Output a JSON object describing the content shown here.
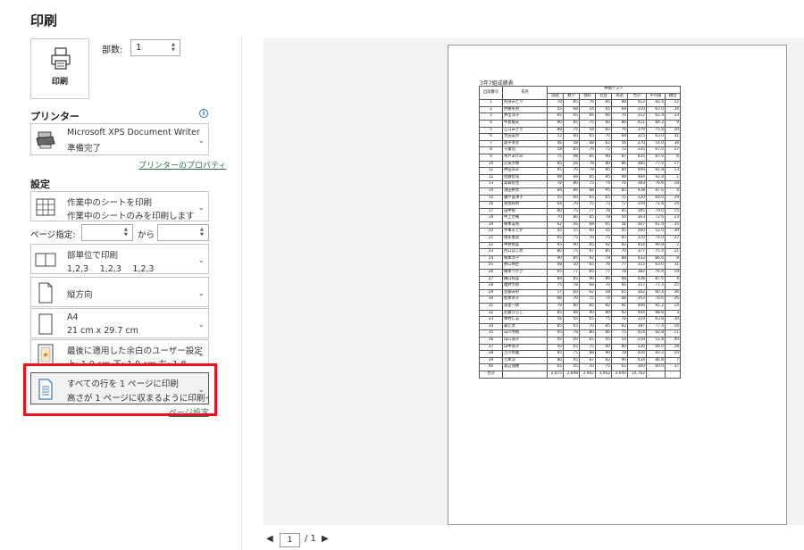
{
  "header": {
    "title": "印刷"
  },
  "print_button": {
    "label": "印刷"
  },
  "copies": {
    "label": "部数:",
    "value": "1"
  },
  "printer": {
    "section_label": "プリンター",
    "info_icon": "i",
    "name": "Microsoft XPS Document Writer",
    "status": "準備完了",
    "properties_link": "プリンターのプロパティ"
  },
  "settings": {
    "section_label": "設定",
    "scope": {
      "line1": "作業中のシートを印刷",
      "line2": "作業中のシートのみを印刷します"
    },
    "pages_label": "ページ指定:",
    "pages_to": "から",
    "collate": {
      "line1": "部単位で印刷",
      "line2": "1,2,3　 1,2,3　 1,2,3"
    },
    "orientation": {
      "line1": "縦方向"
    },
    "paper": {
      "line1": "A4",
      "line2": "21 cm x 29.7 cm"
    },
    "margins": {
      "line1": "最後に適用した余白のユーザー設定",
      "line2": "上: 1.9 cm 下: 1.9 cm 左: 1.8..."
    },
    "scaling": {
      "line1": "すべての行を 1 ページに印刷",
      "line2": "高さが 1 ページに収まるように印刷イ..."
    },
    "page_setup_link": "ページ設定"
  },
  "pager": {
    "current": "1",
    "total": "/ 1"
  },
  "preview": {
    "sheet_title": "3年7組成績表",
    "headers": {
      "num": "出席番号",
      "name": "氏名",
      "group": "中間テスト",
      "subjects": [
        "国語",
        "数学",
        "理科",
        "社会",
        "英語",
        "合計",
        "平均値",
        "順位"
      ]
    },
    "rows": [
      [
        "1",
        "阿部みどり",
        "78",
        "85",
        "76",
        "85",
        "88",
        "412",
        "82.4",
        "12"
      ],
      [
        "2",
        "伊藤冬男",
        "55",
        "68",
        "54",
        "65",
        "68",
        "310",
        "62.0",
        "34"
      ],
      [
        "3",
        "井出洋子",
        "65",
        "45",
        "66",
        "66",
        "70",
        "312",
        "62.4",
        "33"
      ],
      [
        "4",
        "牛島陽夫",
        "90",
        "85",
        "75",
        "85",
        "86",
        "421",
        "84.2",
        "9"
      ],
      [
        "5",
        "江口みさき",
        "88",
        "75",
        "58",
        "82",
        "76",
        "379",
        "75.8",
        "20"
      ],
      [
        "6",
        "大田美奈",
        "52",
        "60",
        "65",
        "70",
        "68",
        "315",
        "63.0",
        "31"
      ],
      [
        "7",
        "奥平孝彦",
        "46",
        "58",
        "48",
        "62",
        "56",
        "270",
        "54.0",
        "38"
      ],
      [
        "8",
        "千葉浩",
        "58",
        "65",
        "70",
        "75",
        "72",
        "335",
        "67.0",
        "27"
      ],
      [
        "9",
        "木戸あけみ",
        "75",
        "98",
        "85",
        "90",
        "87",
        "435",
        "87.0",
        "6"
      ],
      [
        "10",
        "久保大樹",
        "85",
        "56",
        "78",
        "80",
        "86",
        "385",
        "77.0",
        "17"
      ],
      [
        "11",
        "神田あみ",
        "95",
        "70",
        "78",
        "85",
        "84",
        "409",
        "81.8",
        "13"
      ],
      [
        "12",
        "佐藤智道",
        "98",
        "88",
        "85",
        "95",
        "98",
        "464",
        "92.8",
        "1"
      ],
      [
        "13",
        "高森智也",
        "78",
        "80",
        "75",
        "74",
        "76",
        "383",
        "76.6",
        "18"
      ],
      [
        "14",
        "須田裕太",
        "84",
        "86",
        "88",
        "95",
        "85",
        "438",
        "87.6",
        "4"
      ],
      [
        "15",
        "瀬戸美津子",
        "55",
        "60",
        "65",
        "65",
        "75",
        "320",
        "64.0",
        "29"
      ],
      [
        "16",
        "曽我和明",
        "64",
        "70",
        "75",
        "73",
        "77",
        "359",
        "71.8",
        "24"
      ],
      [
        "17",
        "田中郁",
        "80",
        "75",
        "77",
        "78",
        "85",
        "395",
        "79.0",
        "15"
      ],
      [
        "18",
        "中上奈緒",
        "70",
        "80",
        "85",
        "78",
        "50",
        "363",
        "72.6",
        "23"
      ],
      [
        "19",
        "塚本美咲",
        "62",
        "56",
        "68",
        "65",
        "56",
        "307",
        "61.4",
        "35"
      ],
      [
        "20",
        "手塚まどか",
        "45",
        "55",
        "60",
        "55",
        "45",
        "260",
        "52.0",
        "39"
      ],
      [
        "21",
        "徳永篤道",
        "65",
        "75",
        "70",
        "75",
        "85",
        "370",
        "74.0",
        "22"
      ],
      [
        "22",
        "中野明美",
        "95",
        "90",
        "85",
        "92",
        "92",
        "454",
        "90.8",
        "2"
      ],
      [
        "23",
        "西口ほじめ",
        "80",
        "75",
        "67",
        "85",
        "70",
        "377",
        "75.4",
        "21"
      ],
      [
        "24",
        "根本淳子",
        "90",
        "85",
        "92",
        "78",
        "88",
        "433",
        "86.6",
        "8"
      ],
      [
        "25",
        "野口晴臣",
        "48",
        "50",
        "65",
        "76",
        "77",
        "315",
        "63.0",
        "31"
      ],
      [
        "26",
        "橋本つかさ",
        "65",
        "77",
        "85",
        "77",
        "78",
        "382",
        "76.4",
        "19"
      ],
      [
        "27",
        "樋口和美",
        "89",
        "85",
        "90",
        "86",
        "88",
        "438",
        "87.6",
        "4"
      ],
      [
        "28",
        "福井大助",
        "75",
        "78",
        "68",
        "70",
        "66",
        "357",
        "71.4",
        "25"
      ],
      [
        "29",
        "宮脇みお",
        "57",
        "60",
        "62",
        "58",
        "65",
        "302",
        "60.4",
        "36"
      ],
      [
        "30",
        "松本幸子",
        "66",
        "70",
        "75",
        "74",
        "68",
        "353",
        "70.6",
        "26"
      ],
      [
        "31",
        "南里一郎",
        "78",
        "80",
        "85",
        "82",
        "81",
        "406",
        "81.2",
        "14"
      ],
      [
        "32",
        "武藤ひろし",
        "85",
        "88",
        "90",
        "89",
        "92",
        "444",
        "88.8",
        "3"
      ],
      [
        "33",
        "本村仁志",
        "56",
        "45",
        "65",
        "75",
        "78",
        "319",
        "63.8",
        "30"
      ],
      [
        "34",
        "森元太",
        "85",
        "65",
        "70",
        "85",
        "82",
        "387",
        "77.4",
        "16"
      ],
      [
        "35",
        "山川秀樹",
        "95",
        "78",
        "80",
        "86",
        "75",
        "414",
        "82.8",
        "11"
      ],
      [
        "36",
        "山口道子",
        "45",
        "50",
        "65",
        "45",
        "54",
        "259",
        "51.8",
        "40"
      ],
      [
        "37",
        "山中道子",
        "50",
        "65",
        "75",
        "60",
        "80",
        "330",
        "66.0",
        "28"
      ],
      [
        "38",
        "吉川将義",
        "85",
        "75",
        "88",
        "90",
        "78",
        "416",
        "83.2",
        "10"
      ],
      [
        "39",
        "吉本涼",
        "80",
        "95",
        "87",
        "82",
        "90",
        "434",
        "86.8",
        "7"
      ],
      [
        "40",
        "渡辺瑞穂",
        "65",
        "45",
        "50",
        "75",
        "65",
        "300",
        "60.0",
        "37"
      ]
    ],
    "total_row": [
      "合計",
      "",
      "2,875",
      "2,848",
      "2,942",
      "3,062",
      "3,040",
      "14,762",
      "",
      ""
    ]
  }
}
